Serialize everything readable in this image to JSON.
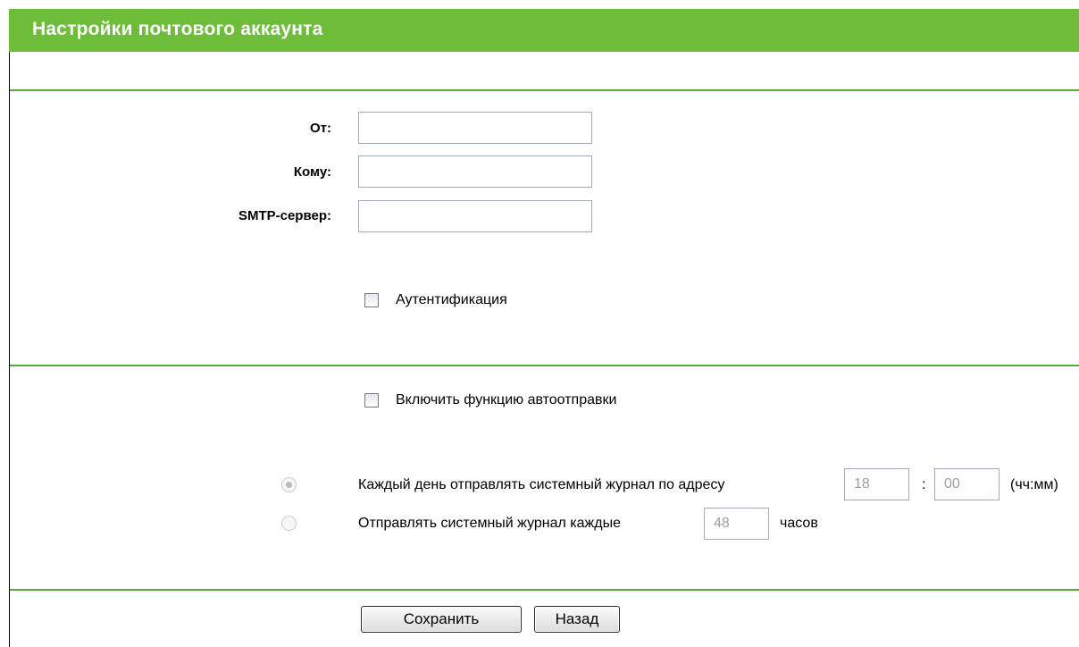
{
  "header": {
    "title": "Настройки почтового аккаунта"
  },
  "account": {
    "from_label": "От:",
    "from_value": "",
    "to_label": "Кому:",
    "to_value": "",
    "smtp_label": "SMTP-сервер:",
    "smtp_value": "",
    "auth_label": "Аутентификация",
    "auth_checked": false
  },
  "autosend": {
    "enable_label": "Включить функцию автоотправки",
    "enable_checked": false,
    "daily_label": "Каждый день отправлять системный журнал по адресу",
    "daily_hour": "18",
    "time_separator": ":",
    "daily_minute": "00",
    "time_format_hint": "(чч:мм)",
    "daily_selected": true,
    "interval_label": "Отправлять системный журнал каждые",
    "interval_hours": "48",
    "interval_unit": "часов",
    "interval_selected": false
  },
  "actions": {
    "save_label": "Сохранить",
    "back_label": "Назад"
  },
  "colors": {
    "title_bar": "#6dbd3a",
    "divider": "#5aa83a"
  }
}
